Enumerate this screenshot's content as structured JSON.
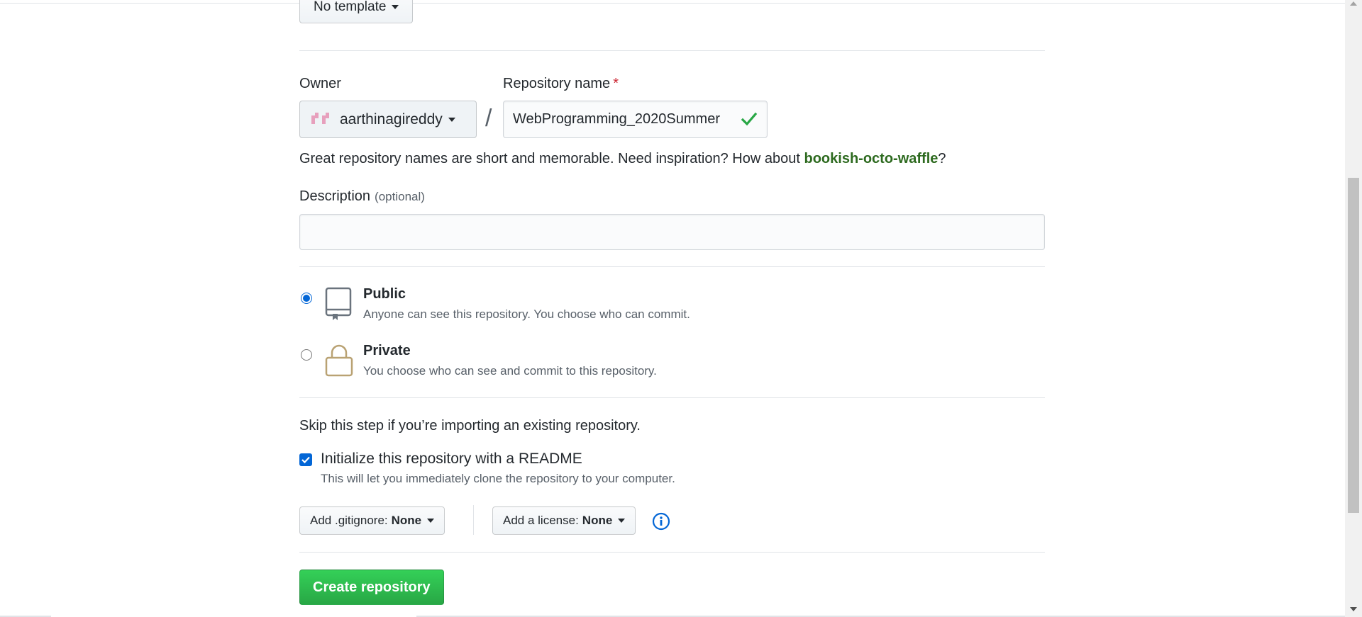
{
  "template": {
    "label": "No template"
  },
  "owner": {
    "label": "Owner",
    "value": "aarthinagireddy"
  },
  "repo_name": {
    "label": "Repository name",
    "required_mark": "*",
    "value": "WebProgramming_2020Summer",
    "separator": "/"
  },
  "hint": {
    "prefix": "Great repository names are short and memorable. Need inspiration? How about ",
    "suggestion": "bookish-octo-waffle",
    "suffix": "?"
  },
  "description": {
    "label": "Description",
    "optional": "(optional)",
    "value": ""
  },
  "visibility": {
    "public": {
      "title": "Public",
      "subtitle": "Anyone can see this repository. You choose who can commit.",
      "checked": true
    },
    "private": {
      "title": "Private",
      "subtitle": "You choose who can see and commit to this repository.",
      "checked": false
    }
  },
  "init": {
    "skip_text": "Skip this step if you’re importing an existing repository.",
    "readme_label": "Initialize this repository with a README",
    "readme_sub": "This will let you immediately clone the repository to your computer.",
    "readme_checked": true
  },
  "gitignore": {
    "label": "Add .gitignore:",
    "value": "None"
  },
  "license": {
    "label": "Add a license:",
    "value": "None"
  },
  "create_button": "Create repository",
  "colors": {
    "primary_green": "#28a745",
    "link_blue": "#0366d6",
    "suggestion_green": "#2d6a1f",
    "required_red": "#cb2431",
    "lock_tan": "#b9a273"
  }
}
